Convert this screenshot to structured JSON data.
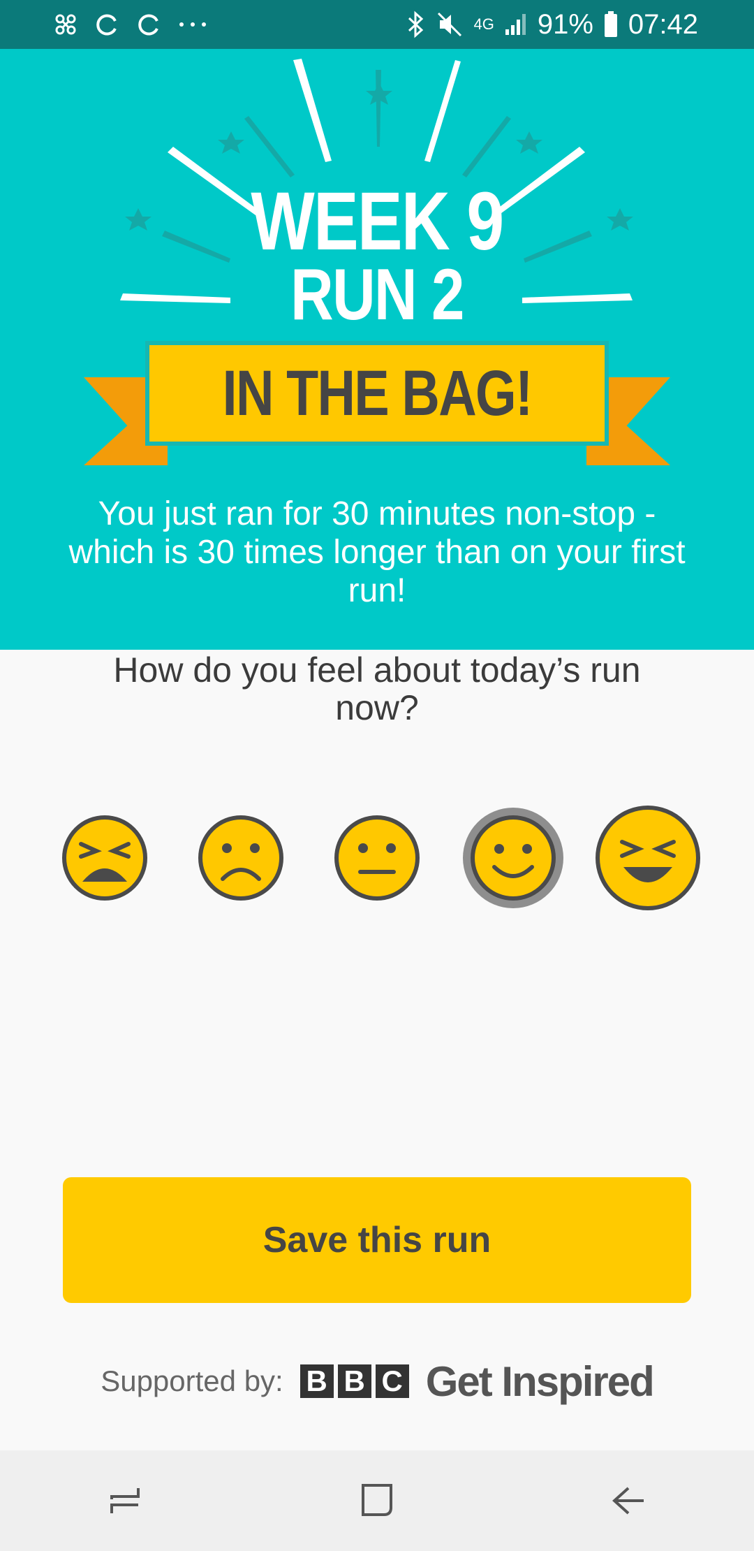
{
  "status_bar": {
    "battery": "91%",
    "time": "07:42",
    "network": "4G",
    "icons": [
      "app-icon",
      "sync-icon",
      "sync-icon",
      "more-icon",
      "bluetooth-icon",
      "mute-icon",
      "signal-icon",
      "battery-icon"
    ]
  },
  "hero": {
    "title_line1": "WEEK 9",
    "title_line2": "RUN 2",
    "banner": "IN THE BAG!",
    "description": "You just ran for 30 minutes non-stop - which is 30 times longer than on your first run!",
    "colors": {
      "background": "#00c9c8",
      "banner": "#ffc800",
      "ribbon": "#f39c0a"
    }
  },
  "feedback": {
    "question": "How do you feel about today’s run now?",
    "options": [
      "very-unhappy-face-icon",
      "sad-face-icon",
      "neutral-face-icon",
      "happy-face-icon",
      "very-happy-face-icon"
    ],
    "selected": "happy-face-icon"
  },
  "cta": {
    "label": "Save this run",
    "color": "#ffca00"
  },
  "footer": {
    "supported_label": "Supported by:",
    "bbc_letters": [
      "B",
      "B",
      "C"
    ],
    "partner_name": "Get Inspired"
  },
  "nav_bar": {
    "buttons": [
      "recent-apps-icon",
      "home-icon",
      "back-icon"
    ]
  }
}
